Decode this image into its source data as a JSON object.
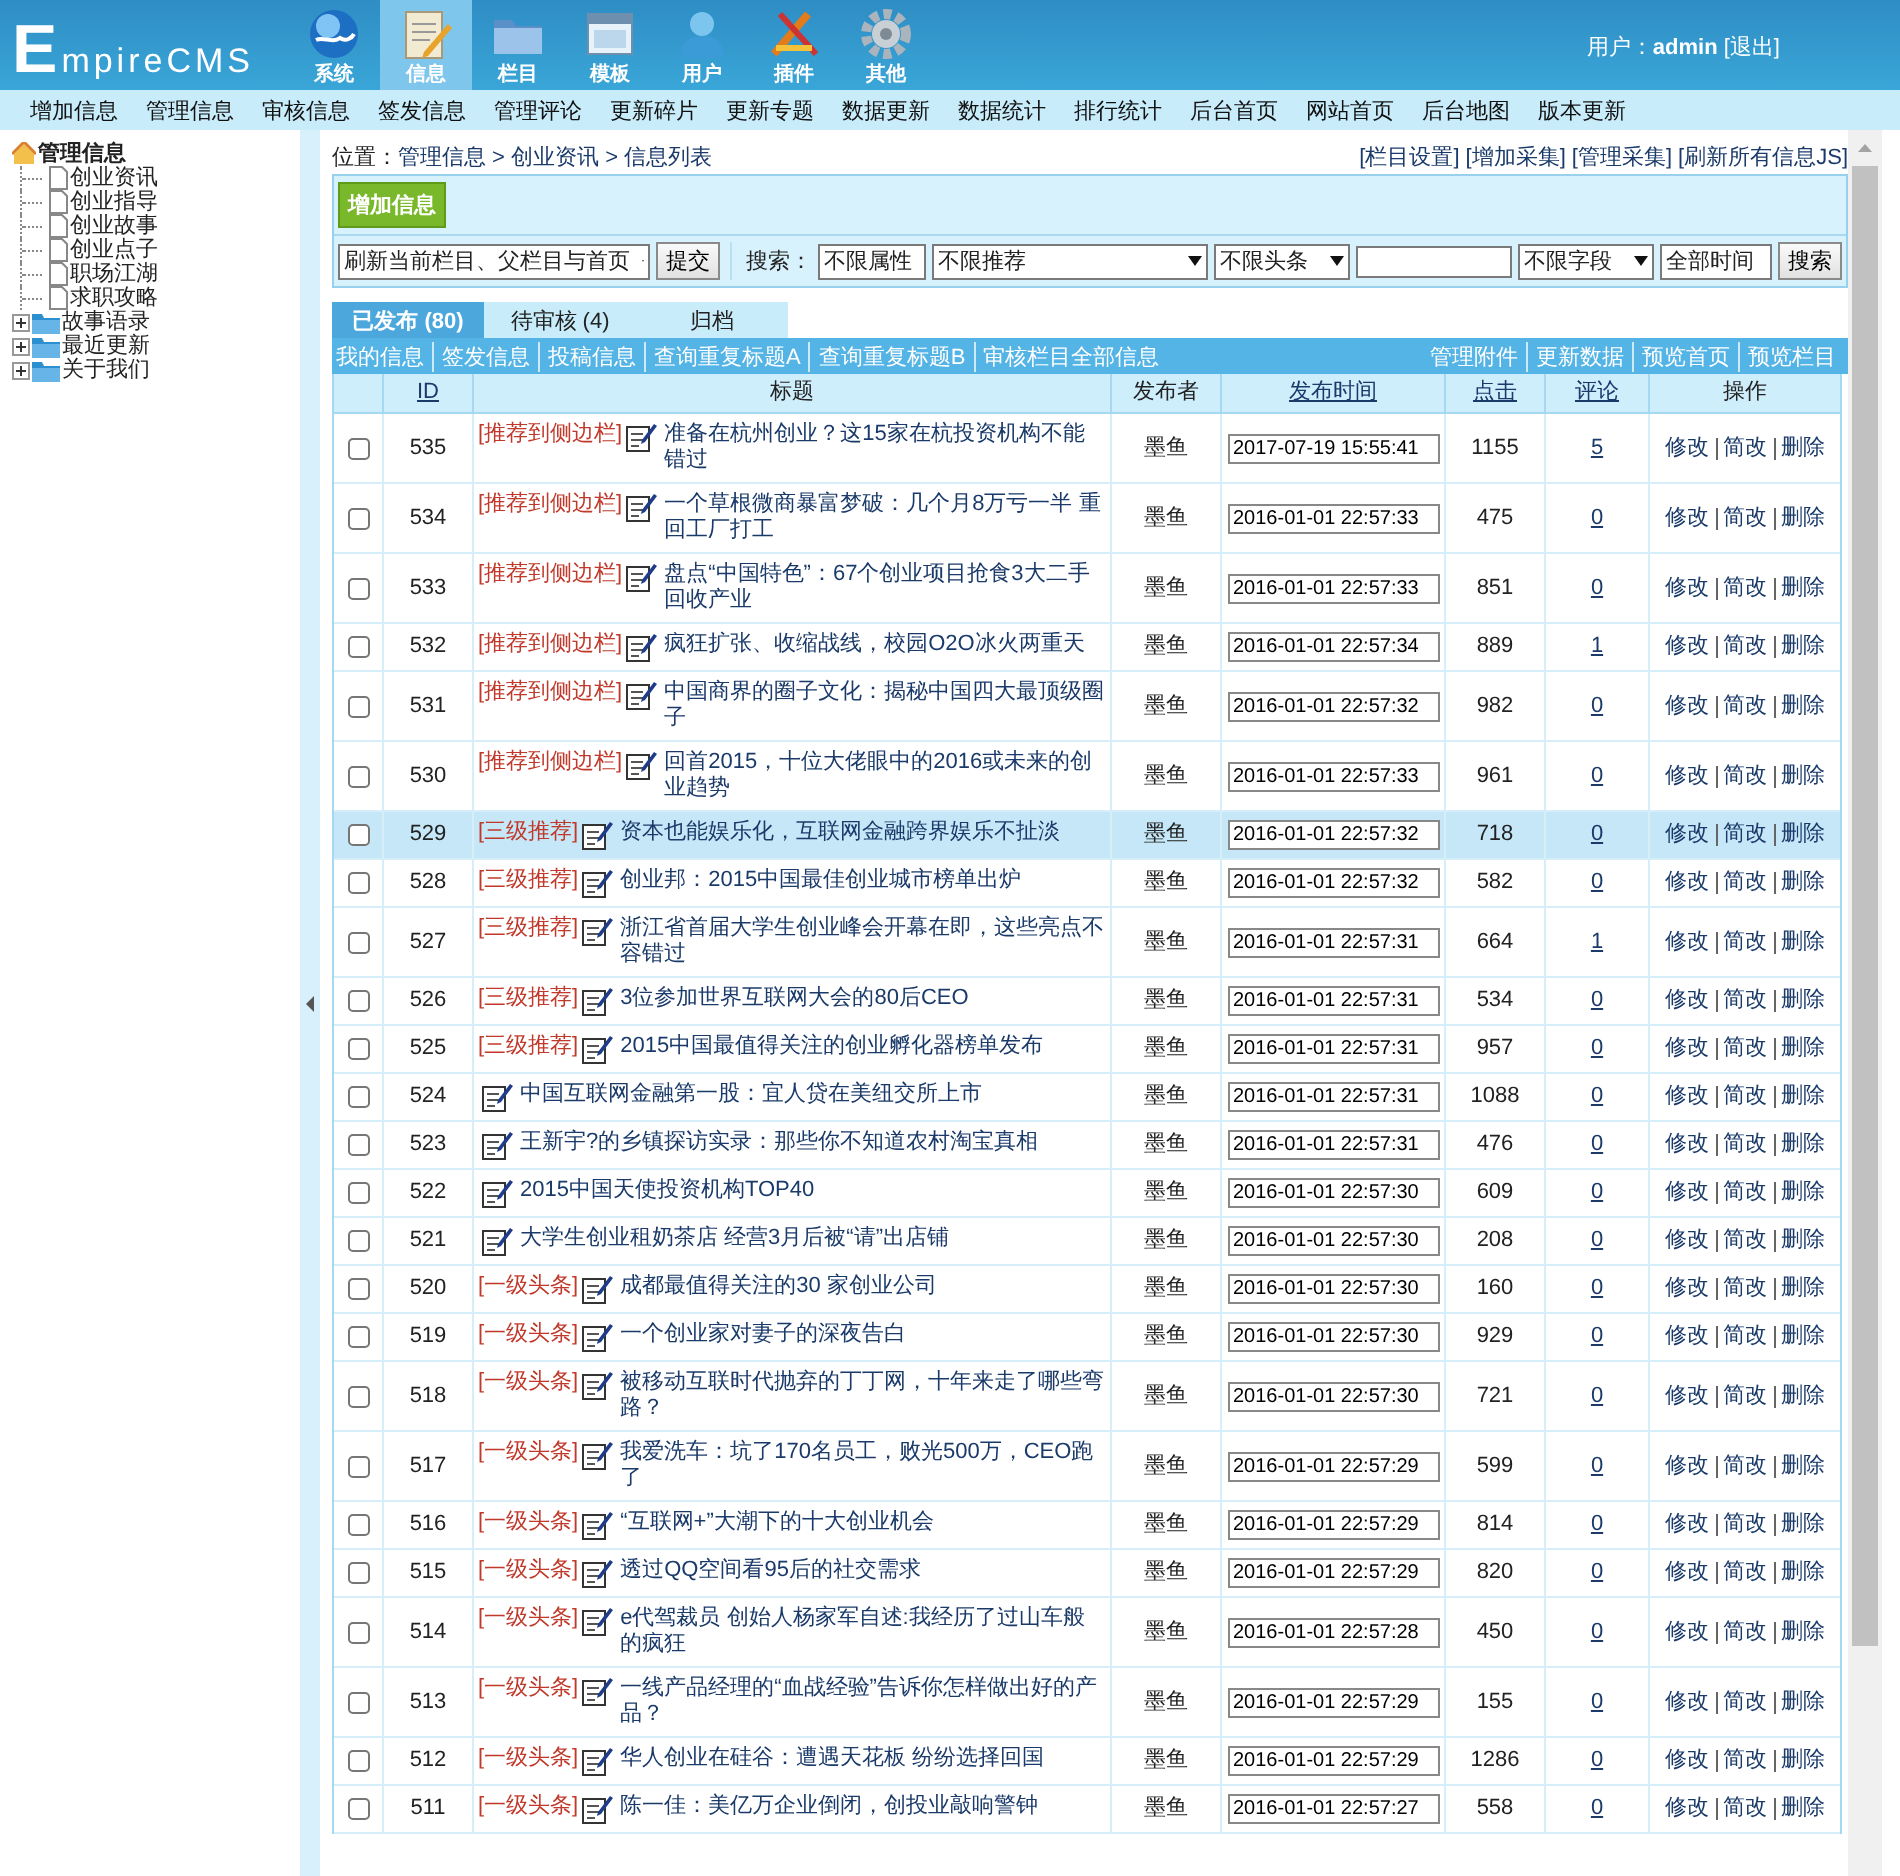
{
  "header": {
    "logo": "EmpireCMS",
    "nav": [
      {
        "label": "系统",
        "selected": false
      },
      {
        "label": "信息",
        "selected": true
      },
      {
        "label": "栏目",
        "selected": false
      },
      {
        "label": "模板",
        "selected": false
      },
      {
        "label": "用户",
        "selected": false
      },
      {
        "label": "插件",
        "selected": false
      },
      {
        "label": "其他",
        "selected": false
      }
    ],
    "user_label": "用户：",
    "user_name": "admin",
    "logout": "[退出]"
  },
  "menu": [
    "增加信息",
    "管理信息",
    "审核信息",
    "签发信息",
    "管理评论",
    "更新碎片",
    "更新专题",
    "数据更新",
    "数据统计",
    "排行统计",
    "后台首页",
    "网站首页",
    "后台地图",
    "版本更新"
  ],
  "sidebar": {
    "items": [
      {
        "label": "管理信息",
        "expanded": true,
        "children": [
          {
            "label": "创业资讯"
          },
          {
            "label": "创业指导"
          },
          {
            "label": "创业故事"
          },
          {
            "label": "创业点子"
          },
          {
            "label": "职场江湖"
          },
          {
            "label": "求职攻略"
          }
        ]
      },
      {
        "label": "故事语录",
        "expanded": false
      },
      {
        "label": "最近更新",
        "expanded": false
      },
      {
        "label": "关于我们",
        "expanded": false
      }
    ]
  },
  "location": {
    "label": "位置：",
    "path": "管理信息 > 创业资讯 > 信息列表",
    "links": [
      "[栏目设置]",
      "[增加采集]",
      "[管理采集]",
      "[刷新所有信息JS]"
    ]
  },
  "toolbar": {
    "add_button": "增加信息",
    "refresh_select": "刷新当前栏目、父栏目与首页",
    "submit_button": "提交",
    "search_label": "搜索：",
    "filters": [
      "不限属性",
      "不限推荐",
      "不限头条"
    ],
    "field_select": "不限字段",
    "time_select": "全部时间",
    "search_button": "搜索"
  },
  "tabs": [
    {
      "label": "已发布 (80)",
      "selected": true
    },
    {
      "label": "待审核 (4)",
      "selected": false
    },
    {
      "label": "归档",
      "selected": false
    }
  ],
  "link_bar": {
    "left": [
      "我的信息",
      "签发信息",
      "投稿信息",
      "查询重复标题A",
      "查询重复标题B",
      "审核栏目全部信息"
    ],
    "right": [
      "管理附件",
      "更新数据",
      "预览首页",
      "预览栏目"
    ]
  },
  "table": {
    "columns": [
      {
        "label": "ID",
        "sortable": true
      },
      {
        "label": "标题",
        "sortable": false
      },
      {
        "label": "发布者",
        "sortable": false
      },
      {
        "label": "发布时间",
        "sortable": true
      },
      {
        "label": "点击",
        "sortable": true
      },
      {
        "label": "评论",
        "sortable": true
      },
      {
        "label": "操作",
        "sortable": false
      }
    ],
    "rows": [
      {
        "selected": false,
        "checked": false,
        "id": "535",
        "tag": "[推荐到侧边栏]",
        "title": "准备在杭州创业？这15家在杭投资机构不能错过",
        "author": "墨鱼",
        "time": "2017-07-19 15:55:41",
        "clicks": "1155",
        "comments": "5",
        "actions": [
          "修改",
          "简改",
          "删除"
        ]
      },
      {
        "selected": false,
        "checked": false,
        "id": "534",
        "tag": "[推荐到侧边栏]",
        "title": "一个草根微商暴富梦破：几个月8万亏一半 重回工厂打工",
        "author": "墨鱼",
        "time": "2016-01-01 22:57:33",
        "clicks": "475",
        "comments": "0",
        "actions": [
          "修改",
          "简改",
          "删除"
        ]
      },
      {
        "selected": false,
        "checked": false,
        "id": "533",
        "tag": "[推荐到侧边栏]",
        "title": "盘点“中国特色”：67个创业项目抢食3大二手回收产业",
        "author": "墨鱼",
        "time": "2016-01-01 22:57:33",
        "clicks": "851",
        "comments": "0",
        "actions": [
          "修改",
          "简改",
          "删除"
        ]
      },
      {
        "selected": false,
        "checked": false,
        "id": "532",
        "tag": "[推荐到侧边栏]",
        "title": "疯狂扩张、收缩战线，校园O2O冰火两重天",
        "author": "墨鱼",
        "time": "2016-01-01 22:57:34",
        "clicks": "889",
        "comments": "1",
        "actions": [
          "修改",
          "简改",
          "删除"
        ]
      },
      {
        "selected": false,
        "checked": false,
        "id": "531",
        "tag": "[推荐到侧边栏]",
        "title": "中国商界的圈子文化：揭秘中国四大最顶级圈子",
        "author": "墨鱼",
        "time": "2016-01-01 22:57:32",
        "clicks": "982",
        "comments": "0",
        "actions": [
          "修改",
          "简改",
          "删除"
        ]
      },
      {
        "selected": false,
        "checked": false,
        "id": "530",
        "tag": "[推荐到侧边栏]",
        "title": "回首2015，十位大佬眼中的2016或未来的创业趋势",
        "author": "墨鱼",
        "time": "2016-01-01 22:57:33",
        "clicks": "961",
        "comments": "0",
        "actions": [
          "修改",
          "简改",
          "删除"
        ]
      },
      {
        "selected": true,
        "checked": false,
        "id": "529",
        "tag": "[三级推荐]",
        "title": "资本也能娱乐化，互联网金融跨界娱乐不扯淡",
        "author": "墨鱼",
        "time": "2016-01-01 22:57:32",
        "clicks": "718",
        "comments": "0",
        "actions": [
          "修改",
          "简改",
          "删除"
        ]
      },
      {
        "selected": false,
        "checked": false,
        "id": "528",
        "tag": "[三级推荐]",
        "title": "创业邦：2015中国最佳创业城市榜单出炉",
        "author": "墨鱼",
        "time": "2016-01-01 22:57:32",
        "clicks": "582",
        "comments": "0",
        "actions": [
          "修改",
          "简改",
          "删除"
        ]
      },
      {
        "selected": false,
        "checked": false,
        "id": "527",
        "tag": "[三级推荐]",
        "title": "浙江省首届大学生创业峰会开幕在即，这些亮点不容错过",
        "author": "墨鱼",
        "time": "2016-01-01 22:57:31",
        "clicks": "664",
        "comments": "1",
        "actions": [
          "修改",
          "简改",
          "删除"
        ]
      },
      {
        "selected": false,
        "checked": false,
        "id": "526",
        "tag": "[三级推荐]",
        "title": "3位参加世界互联网大会的80后CEO",
        "author": "墨鱼",
        "time": "2016-01-01 22:57:31",
        "clicks": "534",
        "comments": "0",
        "actions": [
          "修改",
          "简改",
          "删除"
        ]
      },
      {
        "selected": false,
        "checked": false,
        "id": "525",
        "tag": "[三级推荐]",
        "title": "2015中国最值得关注的创业孵化器榜单发布",
        "author": "墨鱼",
        "time": "2016-01-01 22:57:31",
        "clicks": "957",
        "comments": "0",
        "actions": [
          "修改",
          "简改",
          "删除"
        ]
      },
      {
        "selected": false,
        "checked": false,
        "id": "524",
        "title": "中国互联网金融第一股：宜人贷在美纽交所上市",
        "author": "墨鱼",
        "time": "2016-01-01 22:57:31",
        "clicks": "1088",
        "comments": "0",
        "actions": [
          "修改",
          "简改",
          "删除"
        ]
      },
      {
        "selected": false,
        "checked": false,
        "id": "523",
        "title": "王新宇?的乡镇探访实录：那些你不知道农村淘宝真相",
        "author": "墨鱼",
        "time": "2016-01-01 22:57:31",
        "clicks": "476",
        "comments": "0",
        "actions": [
          "修改",
          "简改",
          "删除"
        ]
      },
      {
        "selected": false,
        "checked": false,
        "id": "522",
        "title": "2015中国天使投资机构TOP40",
        "author": "墨鱼",
        "time": "2016-01-01 22:57:30",
        "clicks": "609",
        "comments": "0",
        "actions": [
          "修改",
          "简改",
          "删除"
        ]
      },
      {
        "selected": false,
        "checked": false,
        "id": "521",
        "title": "大学生创业租奶茶店 经营3月后被“请”出店铺",
        "author": "墨鱼",
        "time": "2016-01-01 22:57:30",
        "clicks": "208",
        "comments": "0",
        "actions": [
          "修改",
          "简改",
          "删除"
        ]
      },
      {
        "selected": false,
        "checked": false,
        "id": "520",
        "tag": "[一级头条]",
        "title": "成都最值得关注的30 家创业公司",
        "author": "墨鱼",
        "time": "2016-01-01 22:57:30",
        "clicks": "160",
        "comments": "0",
        "actions": [
          "修改",
          "简改",
          "删除"
        ]
      },
      {
        "selected": false,
        "checked": false,
        "id": "519",
        "tag": "[一级头条]",
        "title": "一个创业家对妻子的深夜告白",
        "author": "墨鱼",
        "time": "2016-01-01 22:57:30",
        "clicks": "929",
        "comments": "0",
        "actions": [
          "修改",
          "简改",
          "删除"
        ]
      },
      {
        "selected": false,
        "checked": false,
        "id": "518",
        "tag": "[一级头条]",
        "title": "被移动互联时代抛弃的丁丁网，十年来走了哪些弯路？",
        "author": "墨鱼",
        "time": "2016-01-01 22:57:30",
        "clicks": "721",
        "comments": "0",
        "actions": [
          "修改",
          "简改",
          "删除"
        ]
      },
      {
        "selected": false,
        "checked": false,
        "id": "517",
        "tag": "[一级头条]",
        "title": "我爱洗车：坑了170名员工，败光500万，CEO跑了",
        "author": "墨鱼",
        "time": "2016-01-01 22:57:29",
        "clicks": "599",
        "comments": "0",
        "actions": [
          "修改",
          "简改",
          "删除"
        ]
      },
      {
        "selected": false,
        "checked": false,
        "id": "516",
        "tag": "[一级头条]",
        "title": "“互联网+”大潮下的十大创业机会",
        "author": "墨鱼",
        "time": "2016-01-01 22:57:29",
        "clicks": "814",
        "comments": "0",
        "actions": [
          "修改",
          "简改",
          "删除"
        ]
      },
      {
        "selected": false,
        "checked": false,
        "id": "515",
        "tag": "[一级头条]",
        "title": "透过QQ空间看95后的社交需求",
        "author": "墨鱼",
        "time": "2016-01-01 22:57:29",
        "clicks": "820",
        "comments": "0",
        "actions": [
          "修改",
          "简改",
          "删除"
        ]
      },
      {
        "selected": false,
        "checked": false,
        "id": "514",
        "tag": "[一级头条]",
        "title": "e代驾裁员 创始人杨家军自述:我经历了过山车般的疯狂",
        "author": "墨鱼",
        "time": "2016-01-01 22:57:28",
        "clicks": "450",
        "comments": "0",
        "actions": [
          "修改",
          "简改",
          "删除"
        ]
      },
      {
        "selected": false,
        "checked": false,
        "id": "513",
        "tag": "[一级头条]",
        "title": "一线产品经理的“血战经验”告诉你怎样做出好的产品？",
        "author": "墨鱼",
        "time": "2016-01-01 22:57:29",
        "clicks": "155",
        "comments": "0",
        "actions": [
          "修改",
          "简改",
          "删除"
        ]
      },
      {
        "selected": false,
        "checked": false,
        "id": "512",
        "tag": "[一级头条]",
        "title": "华人创业在硅谷：遭遇天花板 纷纷选择回国",
        "author": "墨鱼",
        "time": "2016-01-01 22:57:29",
        "clicks": "1286",
        "comments": "0",
        "actions": [
          "修改",
          "简改",
          "删除"
        ]
      },
      {
        "selected": false,
        "checked": false,
        "id": "511",
        "tag": "[一级头条]",
        "title": "陈一佳：美亿万企业倒闭，创投业敲响警钟",
        "author": "墨鱼",
        "time": "2016-01-01 22:57:27",
        "clicks": "558",
        "comments": "0",
        "actions": [
          "修改",
          "简改",
          "删除"
        ]
      }
    ]
  }
}
